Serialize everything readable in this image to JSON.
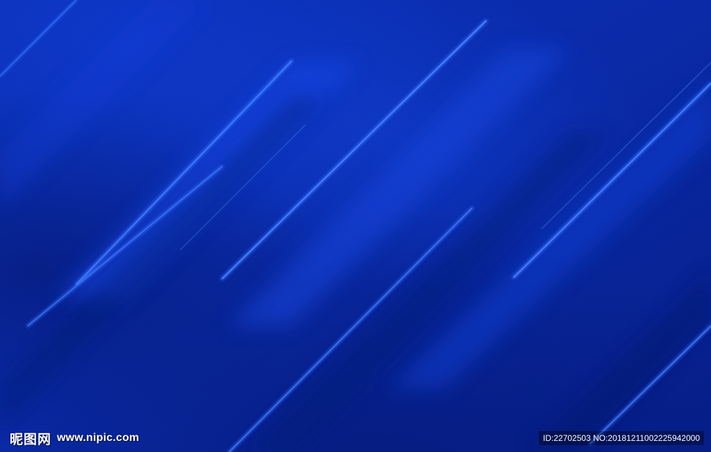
{
  "image": {
    "colors": {
      "base": "#0a2aa8",
      "deep": "#061c7e",
      "mid": "#0b33c6",
      "streak": "#3b7bff",
      "glow": "#1f5cff"
    }
  },
  "watermark": {
    "site_name": "昵图网",
    "url": "www.nipic.com"
  },
  "id_bar": {
    "text": "ID:22702503 NO:20181211002225942000"
  }
}
